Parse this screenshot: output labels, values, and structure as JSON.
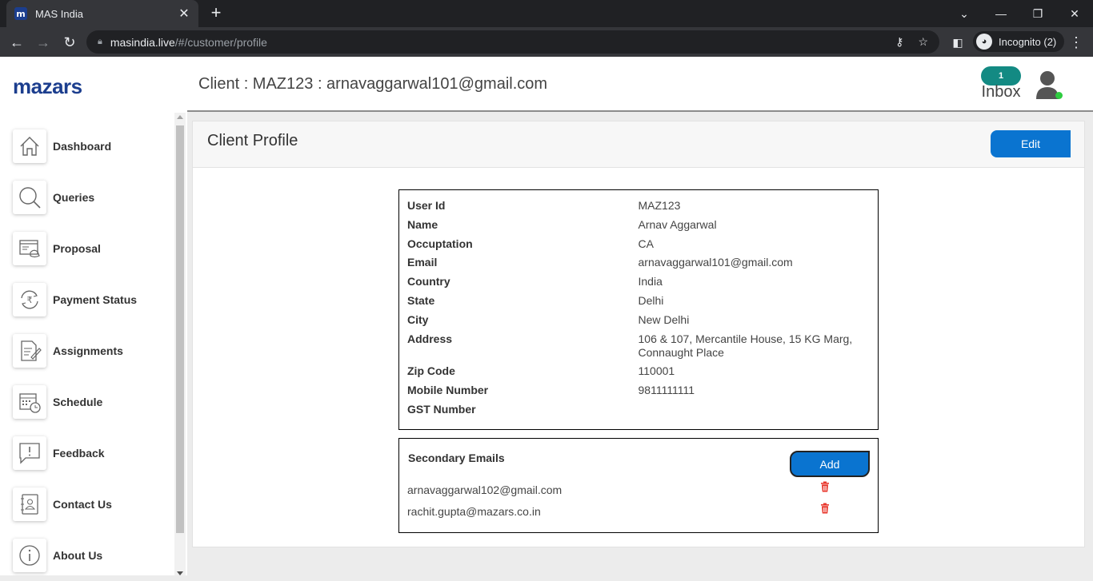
{
  "browser": {
    "tab_title": "MAS India",
    "favicon_letter": "m",
    "url_host": "masindia.live",
    "url_path": "/#/customer/profile",
    "incognito_label": "Incognito (2)"
  },
  "sidebar": {
    "logo": "mazars",
    "items": [
      {
        "label": "Dashboard",
        "icon": "home-icon"
      },
      {
        "label": "Queries",
        "icon": "search-icon"
      },
      {
        "label": "Proposal",
        "icon": "proposal-icon"
      },
      {
        "label": "Payment Status",
        "icon": "rupee-cycle-icon"
      },
      {
        "label": "Assignments",
        "icon": "document-edit-icon"
      },
      {
        "label": "Schedule",
        "icon": "calendar-clock-icon"
      },
      {
        "label": "Feedback",
        "icon": "feedback-icon"
      },
      {
        "label": "Contact Us",
        "icon": "contact-book-icon"
      },
      {
        "label": "About Us",
        "icon": "info-icon"
      }
    ]
  },
  "header": {
    "client_title": "Client : MAZ123 : arnavaggarwal101@gmail.com",
    "inbox_count": "1",
    "inbox_label": "Inbox"
  },
  "profile": {
    "title": "Client Profile",
    "edit_label": "Edit",
    "fields": [
      {
        "key": "User Id",
        "value": "MAZ123"
      },
      {
        "key": "Name",
        "value": "Arnav Aggarwal"
      },
      {
        "key": "Occuptation",
        "value": "CA"
      },
      {
        "key": "Email",
        "value": "arnavaggarwal101@gmail.com"
      },
      {
        "key": "Country",
        "value": "India"
      },
      {
        "key": "State",
        "value": "Delhi"
      },
      {
        "key": "City",
        "value": "New Delhi"
      },
      {
        "key": "Address",
        "value": "106 & 107, Mercantile House, 15 KG Marg, Connaught Place"
      },
      {
        "key": "Zip Code",
        "value": "110001"
      },
      {
        "key": "Mobile Number",
        "value": "9811111111"
      },
      {
        "key": "GST Number",
        "value": ""
      }
    ]
  },
  "secondary": {
    "title": "Secondary Emails",
    "add_label": "Add",
    "emails": [
      "arnavaggarwal102@gmail.com",
      "rachit.gupta@mazars.co.in"
    ]
  },
  "colors": {
    "brand": "#1c3e8e",
    "button": "#0a74d0",
    "badge": "#138a83",
    "trash": "#e8372c",
    "online": "#2ecc40"
  }
}
